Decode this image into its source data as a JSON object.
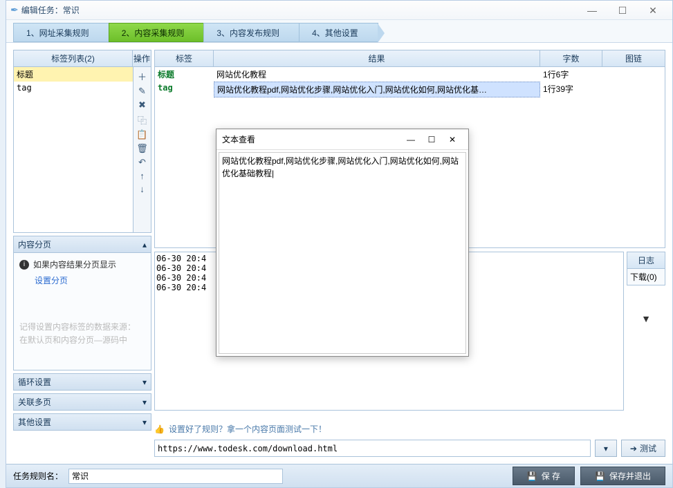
{
  "window": {
    "title": "编辑任务：常识"
  },
  "tabs": [
    "1、网址采集规则",
    "2、内容采集规则",
    "3、内容发布规则",
    "4、其他设置"
  ],
  "tag_panel": {
    "header_list": "标签列表(2)",
    "header_ops": "操作",
    "items": [
      "标题",
      "tag"
    ]
  },
  "sections": {
    "paging": "内容分页",
    "paging_tip": "如果内容结果分页显示",
    "paging_link": "设置分页",
    "hint": "记得设置内容标签的数据来源：\n在默认页和内容分页—源码中",
    "loop": "循环设置",
    "multipage": "关联多页",
    "other": "其他设置"
  },
  "grid": {
    "headers": {
      "tag": "标签",
      "result": "结果",
      "count": "字数",
      "img": "图链"
    },
    "rows": [
      {
        "tag": "标题",
        "result": "网站优化教程",
        "count": "1行6字",
        "img": ""
      },
      {
        "tag": "tag",
        "result": "网站优化教程pdf,网站优化步骤,网站优化入门,网站优化如何,网站优化基…",
        "count": "1行39字",
        "img": ""
      }
    ]
  },
  "log": {
    "header": "日志",
    "download": "下载(0)",
    "lines": "06-30 20:4\n06-30 20:4\n06-30 20:4\n06-30 20:4"
  },
  "test": {
    "msg": "设置好了规则？拿一个内容页面测试一下！",
    "url": "https://www.todesk.com/download.html",
    "btn": "测试"
  },
  "bottom": {
    "label": "任务规则名：",
    "value": "常识",
    "save": "保 存",
    "save_exit": "保存并退出"
  },
  "modal": {
    "title": "文本查看",
    "text": "网站优化教程pdf,网站优化步骤,网站优化入门,网站优化如何,网站优化基础教程"
  }
}
